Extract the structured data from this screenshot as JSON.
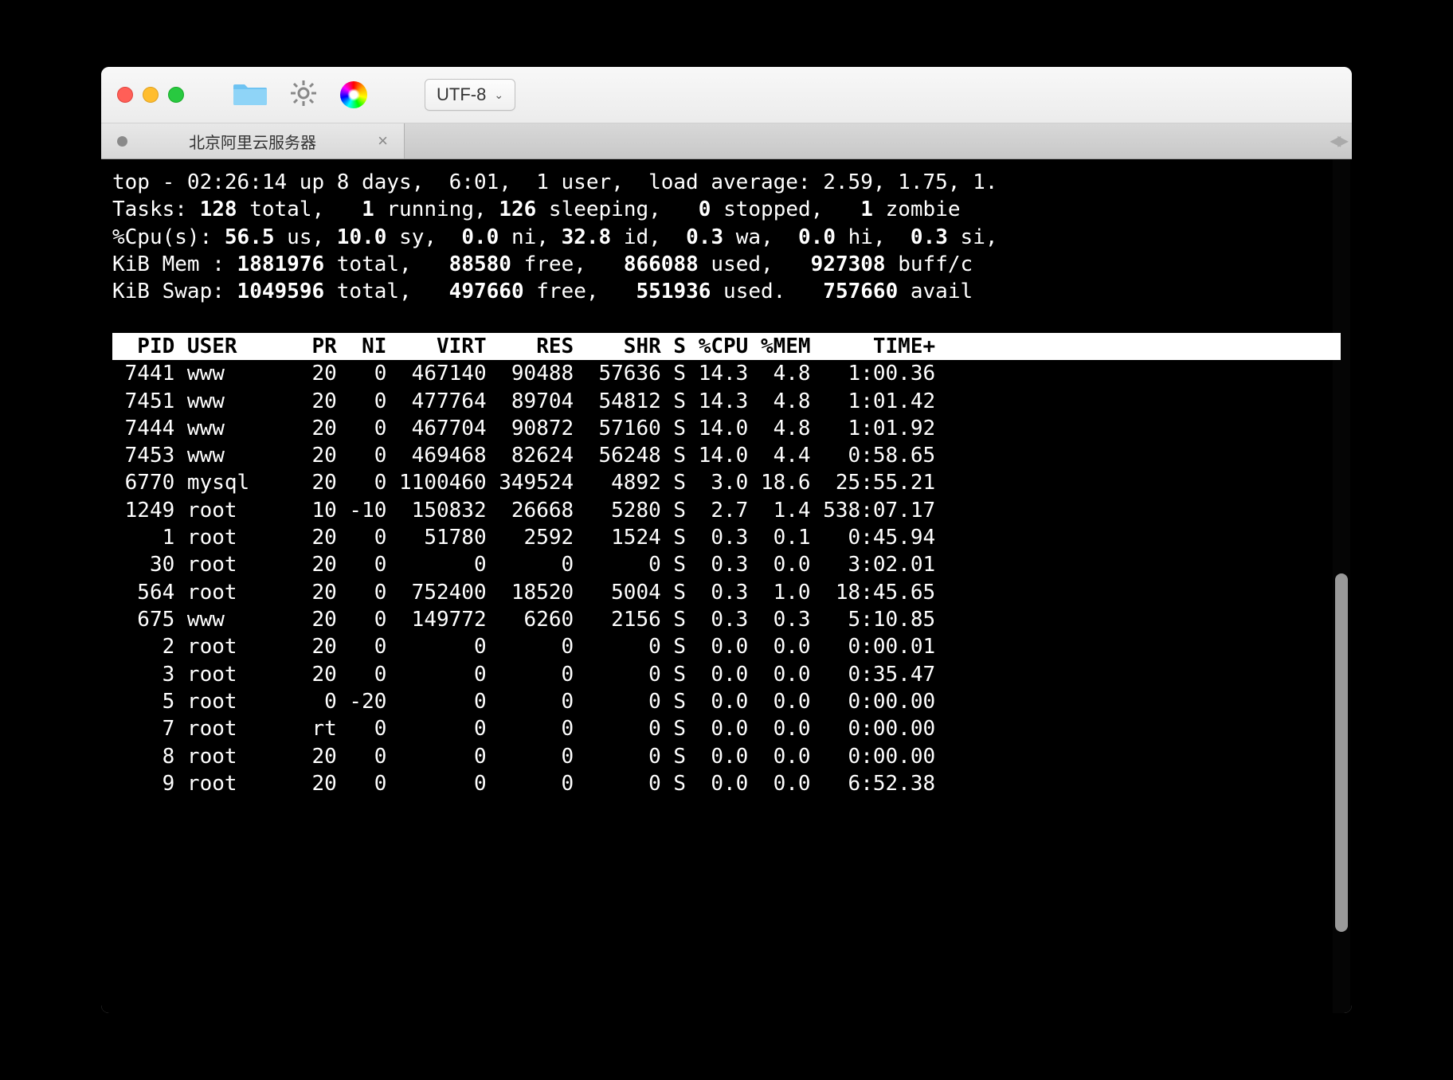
{
  "toolbar": {
    "encoding_label": "UTF-8"
  },
  "tab": {
    "title": "北京阿里云服务器"
  },
  "top_summary": {
    "line1_a": "top - 02:26:14 up 8 days,  6:01,  1 user,  load average: 2.59, 1.75, 1.",
    "tasks_label": "Tasks:",
    "tasks_total_n": "128",
    "tasks_total_t": " total,   ",
    "tasks_run_n": "1",
    "tasks_run_t": " running, ",
    "tasks_sleep_n": "126",
    "tasks_sleep_t": " sleeping,   ",
    "tasks_stop_n": "0",
    "tasks_stop_t": " stopped,   ",
    "tasks_zom_n": "1",
    "tasks_zom_t": " zombie",
    "cpu_label": "%Cpu(s): ",
    "cpu_us_n": "56.5",
    "cpu_us_t": " us, ",
    "cpu_sy_n": "10.0",
    "cpu_sy_t": " sy,  ",
    "cpu_ni_n": "0.0",
    "cpu_ni_t": " ni, ",
    "cpu_id_n": "32.8",
    "cpu_id_t": " id,  ",
    "cpu_wa_n": "0.3",
    "cpu_wa_t": " wa,  ",
    "cpu_hi_n": "0.0",
    "cpu_hi_t": " hi,  ",
    "cpu_si_n": "0.3",
    "cpu_si_t": " si,",
    "mem_label": "KiB Mem : ",
    "mem_tot_n": "1881976",
    "mem_tot_t": " total,   ",
    "mem_free_n": "88580",
    "mem_free_t": " free,   ",
    "mem_used_n": "866088",
    "mem_used_t": " used,   ",
    "mem_buff_n": "927308",
    "mem_buff_t": " buff/c",
    "swap_label": "KiB Swap: ",
    "swap_tot_n": "1049596",
    "swap_tot_t": " total,   ",
    "swap_free_n": "497660",
    "swap_free_t": " free,   ",
    "swap_used_n": "551936",
    "swap_used_t": " used.   ",
    "swap_avail_n": "757660",
    "swap_avail_t": " avail"
  },
  "header_row": "  PID USER      PR  NI    VIRT    RES    SHR S %CPU %MEM     TIME+ ",
  "rows": [
    " 7441 www       20   0  467140  90488  57636 S 14.3  4.8   1:00.36",
    " 7451 www       20   0  477764  89704  54812 S 14.3  4.8   1:01.42",
    " 7444 www       20   0  467704  90872  57160 S 14.0  4.8   1:01.92",
    " 7453 www       20   0  469468  82624  56248 S 14.0  4.4   0:58.65",
    " 6770 mysql     20   0 1100460 349524   4892 S  3.0 18.6  25:55.21",
    " 1249 root      10 -10  150832  26668   5280 S  2.7  1.4 538:07.17",
    "    1 root      20   0   51780   2592   1524 S  0.3  0.1   0:45.94",
    "   30 root      20   0       0      0      0 S  0.3  0.0   3:02.01",
    "  564 root      20   0  752400  18520   5004 S  0.3  1.0  18:45.65",
    "  675 www       20   0  149772   6260   2156 S  0.3  0.3   5:10.85",
    "    2 root      20   0       0      0      0 S  0.0  0.0   0:00.01",
    "    3 root      20   0       0      0      0 S  0.0  0.0   0:35.47",
    "    5 root       0 -20       0      0      0 S  0.0  0.0   0:00.00",
    "    7 root      rt   0       0      0      0 S  0.0  0.0   0:00.00",
    "    8 root      20   0       0      0      0 S  0.0  0.0   0:00.00",
    "    9 root      20   0       0      0      0 S  0.0  0.0   6:52.38"
  ]
}
